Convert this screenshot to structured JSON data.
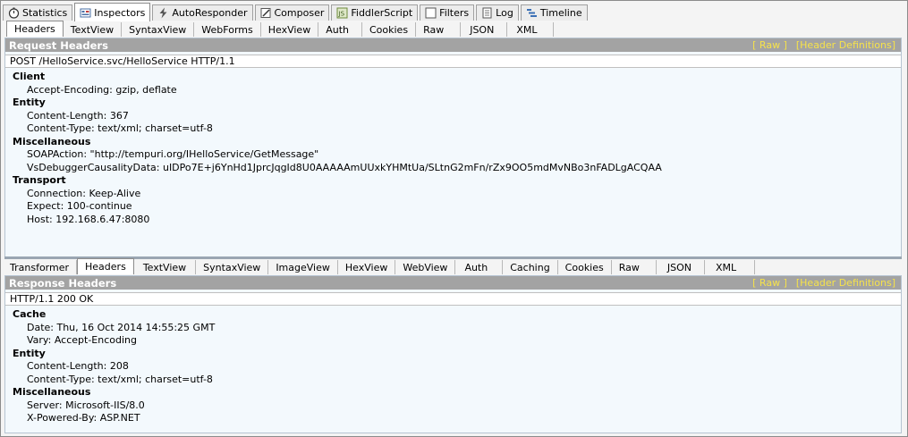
{
  "top_tabs": [
    {
      "label": "Statistics",
      "icon": "stopwatch-icon",
      "active": false
    },
    {
      "label": "Inspectors",
      "icon": "inspectors-icon",
      "active": true
    },
    {
      "label": "AutoResponder",
      "icon": "lightning-icon",
      "active": false
    },
    {
      "label": "Composer",
      "icon": "pencil-icon",
      "active": false
    },
    {
      "label": "FiddlerScript",
      "icon": "script-icon",
      "active": false
    },
    {
      "label": "Filters",
      "icon": "checkbox-icon",
      "active": false
    },
    {
      "label": "Log",
      "icon": "log-icon",
      "active": false
    },
    {
      "label": "Timeline",
      "icon": "timeline-icon",
      "active": false
    }
  ],
  "request": {
    "tabs": [
      "Headers",
      "TextView",
      "SyntaxView",
      "WebForms",
      "HexView",
      "Auth",
      "Cookies",
      "Raw",
      "JSON",
      "XML"
    ],
    "active_tab": "Headers",
    "title": "Request Headers",
    "raw_link": "[ Raw ]",
    "defs_link": "[Header Definitions]",
    "request_line": "POST /HelloService.svc/HelloService HTTP/1.1",
    "groups": [
      {
        "name": "Client",
        "items": [
          "Accept-Encoding: gzip, deflate"
        ]
      },
      {
        "name": "Entity",
        "items": [
          "Content-Length: 367",
          "Content-Type: text/xml; charset=utf-8"
        ]
      },
      {
        "name": "Miscellaneous",
        "items": [
          "SOAPAction: \"http://tempuri.org/IHelloService/GetMessage\"",
          "VsDebuggerCausalityData: uIDPo7E+j6YnHd1JprcJqgId8U0AAAAAmUUxkYHMtUa/SLtnG2mFn/rZx9OO5mdMvNBo3nFADLgACQAA"
        ]
      },
      {
        "name": "Transport",
        "items": [
          "Connection: Keep-Alive",
          "Expect: 100-continue",
          "Host: 192.168.6.47:8080"
        ]
      }
    ]
  },
  "response": {
    "tabs": [
      "Transformer",
      "Headers",
      "TextView",
      "SyntaxView",
      "ImageView",
      "HexView",
      "WebView",
      "Auth",
      "Caching",
      "Cookies",
      "Raw",
      "JSON",
      "XML"
    ],
    "active_tab": "Headers",
    "title": "Response Headers",
    "raw_link": "[ Raw ]",
    "defs_link": "[Header Definitions]",
    "status_line": "HTTP/1.1 200 OK",
    "groups": [
      {
        "name": "Cache",
        "items": [
          "Date: Thu, 16 Oct 2014 14:55:25 GMT",
          "Vary: Accept-Encoding"
        ]
      },
      {
        "name": "Entity",
        "items": [
          "Content-Length: 208",
          "Content-Type: text/xml; charset=utf-8"
        ]
      },
      {
        "name": "Miscellaneous",
        "items": [
          "Server: Microsoft-IIS/8.0",
          "X-Powered-By: ASP.NET"
        ]
      }
    ]
  }
}
